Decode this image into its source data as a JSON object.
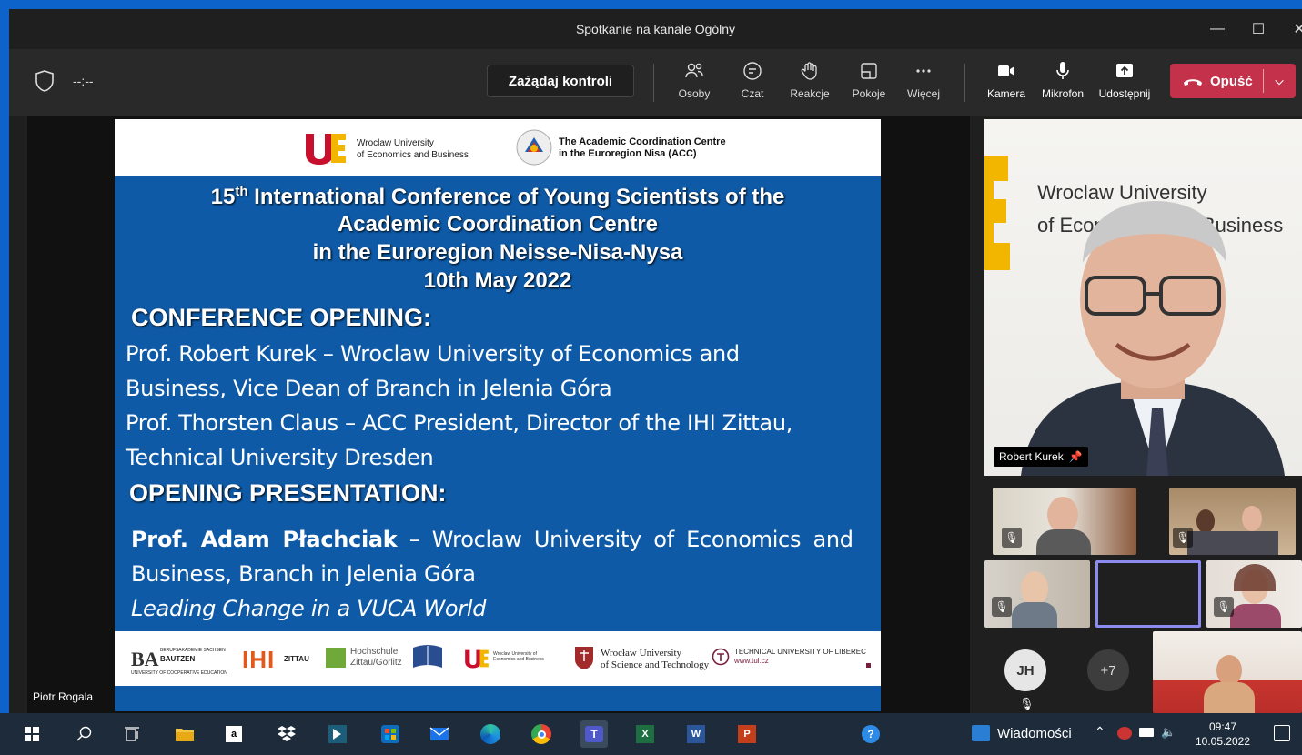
{
  "window": {
    "title": "Spotkanie na kanale Ogólny"
  },
  "toolbar": {
    "timer": "--:--",
    "request_control": "Zażądaj kontroli",
    "people": "Osoby",
    "chat": "Czat",
    "reactions": "Reakcje",
    "rooms": "Pokoje",
    "more": "Więcej",
    "camera": "Kamera",
    "mic": "Mikrofon",
    "share": "Udostępnij",
    "leave": "Opuść"
  },
  "slide": {
    "logo1": {
      "line1": "Wroclaw University",
      "line2": "of Economics and Business"
    },
    "logo2": {
      "line1": "The Academic Coordination Centre",
      "line2": "in the Euroregion Nisa (ACC)"
    },
    "title_num": "15",
    "title_sup": "th",
    "title_l1": " International Conference of Young Scientists of the",
    "title_l2": "Academic Coordination Centre",
    "title_l3": "in the Euroregion Neisse-Nisa-Nysa",
    "title_l4": "10th May 2022",
    "h1": "CONFERENCE OPENING:",
    "p1": "Prof. Robert Kurek – Wroclaw University of Economics and",
    "p2": "Business, Vice Dean of Branch in Jelenia Góra",
    "p3": "Prof. Thorsten Claus – ACC President, Director of the IHI Zittau,",
    "p4": "Technical University Dresden",
    "h2": "OPENING PRESENTATION:",
    "p5_bold": "Prof. Adam Płachciak",
    "p5_rest": " – Wroclaw University of Economics and",
    "p6": "Business, Branch in Jelenia Góra",
    "p7": "Leading Change in a VUCA World",
    "footer": {
      "ba": "BA",
      "ba_small": "BERUFSAKADEMIE SACHSEN",
      "ba_city": "BAUTZEN",
      "ba_sub": "UNIVERSITY OF COOPERATIVE EDUCATION",
      "ihi": "IHI",
      "ihi_small": "ZITTAU",
      "hs": "Hochschule",
      "hs2": "Zittau/Görlitz",
      "ue_small": "Wroclaw University of Economics and Business",
      "pwr1": "Wrocław University",
      "pwr2": "of Science and Technology",
      "tul1": "TECHNICAL UNIVERSITY OF LIBEREC",
      "tul2": "www.tul.cz"
    }
  },
  "presenter_name": "Piotr Rogala",
  "speaker": {
    "name": "Robert Kurek",
    "bg_text1": "Wroclaw University",
    "bg_text2": "of Economics and Business"
  },
  "participants": {
    "avatar_initials": "JH",
    "more_count": "+7"
  },
  "taskbar": {
    "news": "Wiadomości",
    "time": "09:47",
    "date": "10.05.2022"
  }
}
